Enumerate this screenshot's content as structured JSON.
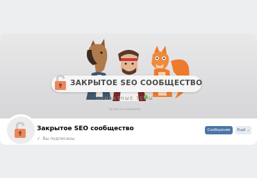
{
  "cover": {
    "banner_title": "ЗАКРЫТОЕ SEO СООБЩЕСТВО",
    "banner_subtitle": "ПРИВАТНЫЕ ТЕМЫ",
    "banner_tiny": "by top-seo community"
  },
  "group": {
    "name": "Закрытое SEO сообщество",
    "subscribed_text": "Вы подписаны",
    "avatar_icon": "padlock-icon"
  },
  "actions": {
    "message_label": "Сообщение",
    "more_label": "Ещё"
  },
  "colors": {
    "primary_button": "#4a76a8",
    "secondary_button": "#e5ebf1",
    "page_background": "#edeef0",
    "lock_orange": "#e9885c"
  }
}
